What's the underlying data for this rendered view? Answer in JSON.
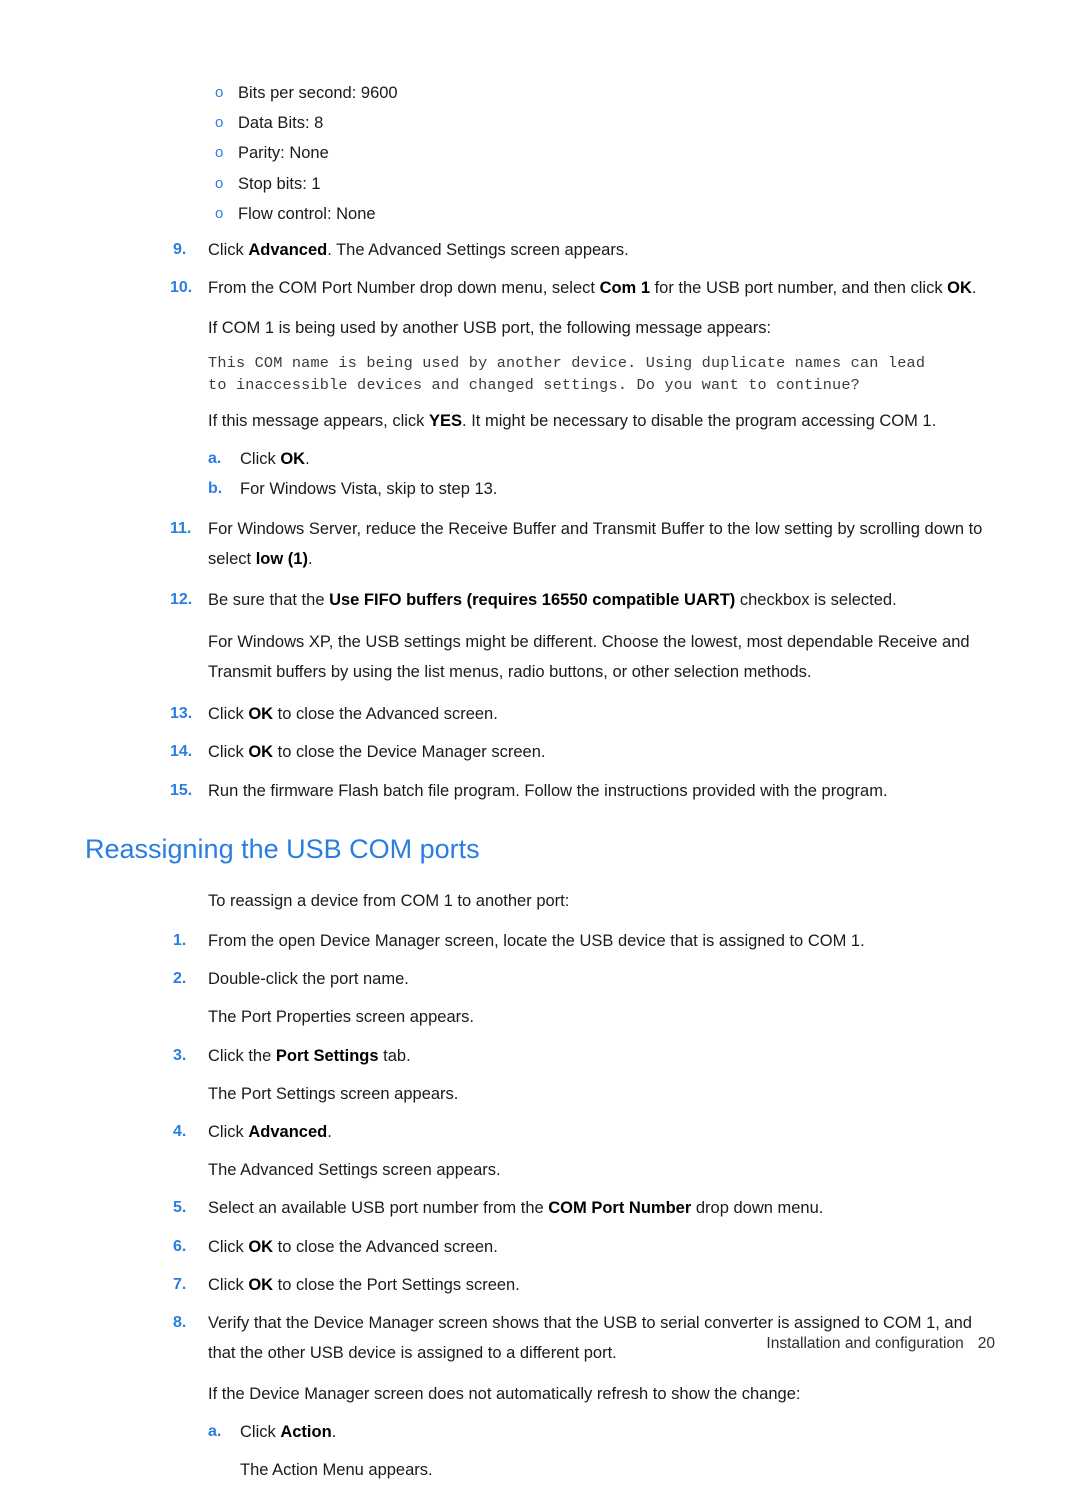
{
  "document": {
    "bullets": [
      {
        "marker": "o",
        "text": "Bits per second: 9600"
      },
      {
        "marker": "o",
        "text": "Data Bits: 8"
      },
      {
        "marker": "o",
        "text": "Parity: None"
      },
      {
        "marker": "o",
        "text": "Stop bits: 1"
      },
      {
        "marker": "o",
        "text": "Flow control: None"
      }
    ],
    "step9": {
      "num": "9.",
      "pre": "Click ",
      "bold": "Advanced",
      "post": ". The Advanced Settings screen appears."
    },
    "step10": {
      "num": "10.",
      "pre": "From the COM Port Number drop down menu, select ",
      "bold1": "Com 1",
      "mid": " for the USB port number, and then click ",
      "bold2": "OK",
      "post": "."
    },
    "com1_note": "If COM 1 is being used by another USB port, the following message appears:",
    "mono_message": {
      "line1": "This COM name is being used by another device. Using duplicate names can lead",
      "line2": "to inaccessible devices and changed settings. Do you want to continue?"
    },
    "yes_note": {
      "pre": "If this message appears, click ",
      "bold": "YES",
      "post": ". It might be necessary to disable the program accessing COM 1."
    },
    "sub_a_10": {
      "letter": "a.",
      "pre": "Click ",
      "bold": "OK",
      "post": "."
    },
    "sub_b_10": {
      "letter": "b.",
      "text": "For Windows Vista, skip to step 13."
    },
    "step11": {
      "num": "11.",
      "pre": "For Windows Server, reduce the Receive Buffer and Transmit Buffer to the low setting by scrolling down to select ",
      "bold": "low (1)",
      "post": "."
    },
    "step12": {
      "num": "12.",
      "pre": "Be sure that the ",
      "bold": "Use FIFO buffers (requires 16550 compatible UART)",
      "post": " checkbox is selected."
    },
    "winxp_note": "For Windows XP, the USB settings might be different. Choose the lowest, most dependable Receive and Transmit buffers by using the list menus, radio buttons, or other selection methods.",
    "step13": {
      "num": "13.",
      "pre": "Click ",
      "bold": "OK",
      "post": " to close the Advanced screen."
    },
    "step14": {
      "num": "14.",
      "pre": "Click ",
      "bold": "OK",
      "post": " to close the Device Manager screen."
    },
    "step15": {
      "num": "15.",
      "text": "Run the firmware Flash batch file program. Follow the instructions provided with the program."
    },
    "heading": "Reassigning the USB COM ports",
    "intro": "To reassign a device from COM 1 to another port:",
    "r_step1": {
      "num": "1.",
      "text": "From the open Device Manager screen, locate the USB device that is assigned to COM 1."
    },
    "r_step2": {
      "num": "2.",
      "text": "Double-click the port name."
    },
    "r_note2": "The Port Properties screen appears.",
    "r_step3": {
      "num": "3.",
      "pre": "Click the ",
      "bold": "Port Settings",
      "post": " tab."
    },
    "r_note3": "The Port Settings screen appears.",
    "r_step4": {
      "num": "4.",
      "pre": "Click ",
      "bold": "Advanced",
      "post": "."
    },
    "r_note4": "The Advanced Settings screen appears.",
    "r_step5": {
      "num": "5.",
      "pre": "Select an available USB port number from the ",
      "bold": "COM Port Number",
      "post": " drop down menu."
    },
    "r_step6": {
      "num": "6.",
      "pre": "Click ",
      "bold": "OK",
      "post": " to close the Advanced screen."
    },
    "r_step7": {
      "num": "7.",
      "pre": "Click ",
      "bold": "OK",
      "post": " to close the Port Settings screen."
    },
    "r_step8": {
      "num": "8.",
      "text": "Verify that the Device Manager screen shows that the USB to serial converter is assigned to COM 1, and that the other USB device is assigned to a different port."
    },
    "r_note8": "If the Device Manager screen does not automatically refresh to show the change:",
    "r_sub_a8": {
      "letter": "a.",
      "pre": "Click ",
      "bold": "Action",
      "post": "."
    },
    "r_note_a8": "The Action Menu appears.",
    "footer": {
      "label": "Installation and configuration",
      "page": "20"
    }
  },
  "colors": {
    "accent_blue": "#2a7de1",
    "body_text": "#1a1a1a",
    "mono_text": "#3a3a3a"
  }
}
